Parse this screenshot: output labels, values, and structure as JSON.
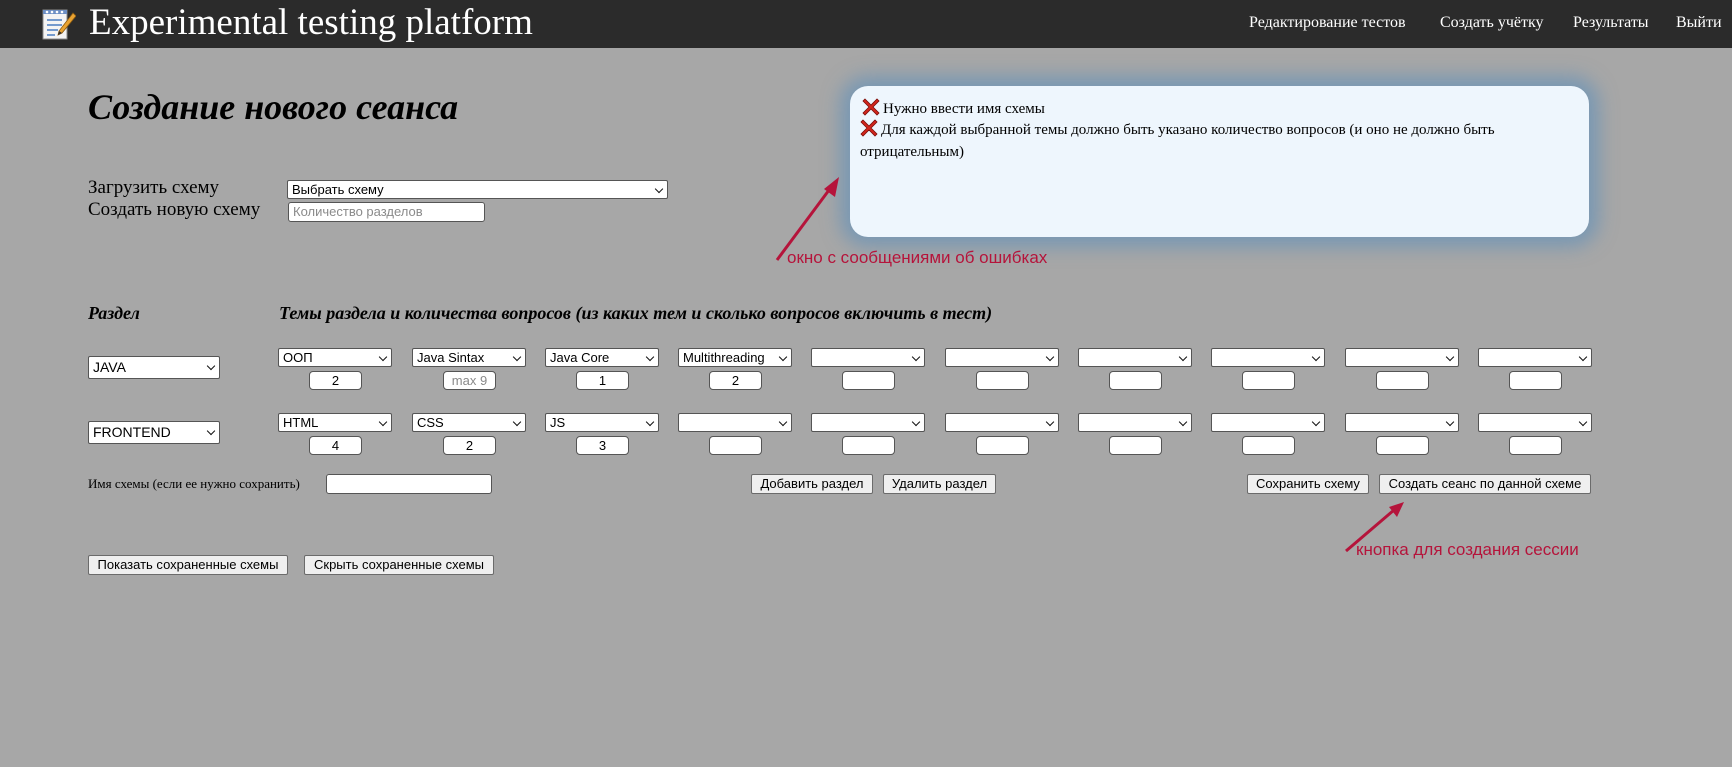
{
  "header": {
    "title": "Experimental testing platform",
    "nav": [
      "Редактирование тестов",
      "Создать учётку",
      "Результаты",
      "Выйти"
    ]
  },
  "page": {
    "heading": "Создание нового сеанса",
    "load_scheme_label": "Загрузить схему",
    "load_scheme_value": "Выбрать схему",
    "new_scheme_label": "Создать новую схему",
    "new_scheme_placeholder": "Количество разделов"
  },
  "errors": {
    "messages": [
      "Нужно ввести имя схемы",
      "Для каждой выбранной темы должно быть указано количество вопросов (и оно не должно быть отрицательным)"
    ]
  },
  "annotations": {
    "errors": "окно с сообщениями об ошибках",
    "button": "кнопка для создания сессии"
  },
  "table": {
    "section_header": "Раздел",
    "topics_header": "Темы раздела и количества вопросов (из каких тем и сколько вопросов включить в тест)",
    "rows": [
      {
        "section": "JAVA",
        "topics": [
          "ООП",
          "Java Sintax",
          "Java Core",
          "Multithreading",
          "",
          "",
          "",
          "",
          "",
          ""
        ],
        "counts": [
          "2",
          "",
          "1",
          "2",
          "",
          "",
          "",
          "",
          "",
          ""
        ],
        "placeholders": [
          "",
          "max 9",
          "",
          "",
          "",
          "",
          "",
          "",
          "",
          ""
        ]
      },
      {
        "section": "FRONTEND",
        "topics": [
          "HTML",
          "CSS",
          "JS",
          "",
          "",
          "",
          "",
          "",
          "",
          ""
        ],
        "counts": [
          "4",
          "2",
          "3",
          "",
          "",
          "",
          "",
          "",
          "",
          ""
        ],
        "placeholders": [
          "",
          "",
          "",
          "",
          "",
          "",
          "",
          "",
          "",
          ""
        ]
      }
    ]
  },
  "controls": {
    "scheme_name_label": "Имя схемы (если ее нужно сохранить)",
    "scheme_name_value": "",
    "add_section": "Добавить раздел",
    "delete_section": "Удалить раздел",
    "save_scheme": "Сохранить схему",
    "create_session": "Создать сеанс по данной схеме",
    "show_saved": "Показать сохраненные схемы",
    "hide_saved": "Скрыть сохраненные схемы"
  },
  "colors": {
    "background": "#a7a7a7",
    "header": "#2b2b2b",
    "error_box": "#eef6fd",
    "error_glow": "#548cbe",
    "annotation": "#b5143b",
    "error_icon": "#d3261d"
  },
  "icons": {
    "logo": "notepad-pencil-icon",
    "error": "red-x-icon"
  }
}
